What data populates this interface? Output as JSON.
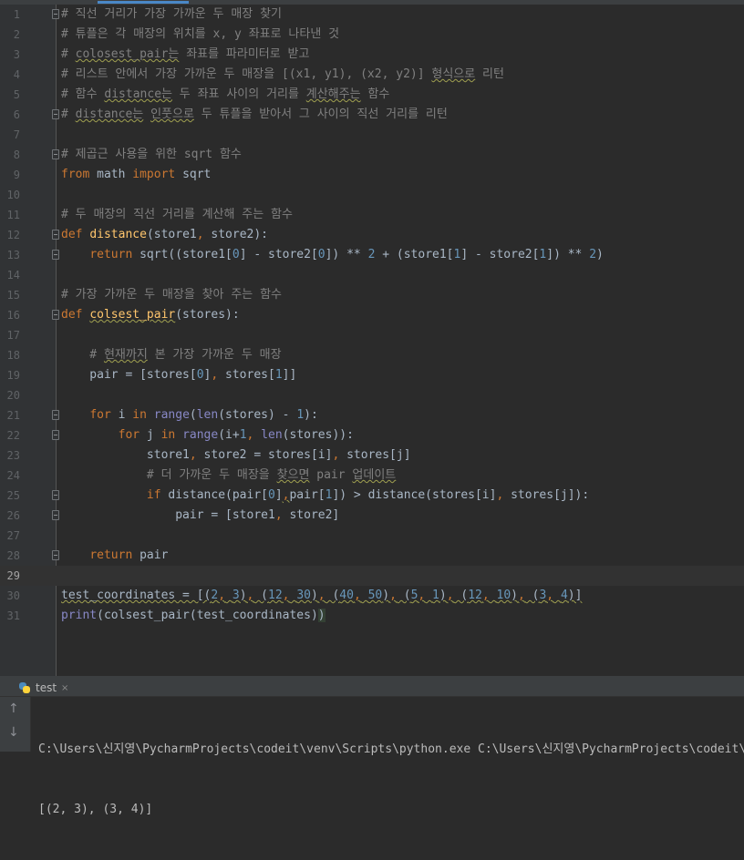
{
  "editor": {
    "lines": [
      {
        "n": "1",
        "fold": true,
        "tokens": [
          {
            "t": "# 직선 거리가 가장 가까운 두 매장 찾기",
            "c": "comment"
          }
        ]
      },
      {
        "n": "2",
        "tokens": [
          {
            "t": "# 튜플은 각 매장의 위치를 x, y 좌표로 나타낸 것",
            "c": "comment"
          }
        ]
      },
      {
        "n": "3",
        "tokens": [
          {
            "t": "# ",
            "c": "comment"
          },
          {
            "t": "colosest_pair는",
            "c": "comment warn"
          },
          {
            "t": " 좌표를 파라미터로 받고",
            "c": "comment"
          }
        ]
      },
      {
        "n": "4",
        "tokens": [
          {
            "t": "# 리스트 안에서 가장 가까운 두 매장을 [(x1, y1), (x2, y2)] ",
            "c": "comment"
          },
          {
            "t": "형식으로",
            "c": "comment warn"
          },
          {
            "t": " 리턴",
            "c": "comment"
          }
        ]
      },
      {
        "n": "5",
        "tokens": [
          {
            "t": "# 함수 ",
            "c": "comment"
          },
          {
            "t": "distance는",
            "c": "comment warn"
          },
          {
            "t": " 두 좌표 사이의 거리를 ",
            "c": "comment"
          },
          {
            "t": "계산해주는",
            "c": "comment warn"
          },
          {
            "t": " 함수",
            "c": "comment"
          }
        ]
      },
      {
        "n": "6",
        "fold": true,
        "tokens": [
          {
            "t": "# ",
            "c": "comment"
          },
          {
            "t": "distance는",
            "c": "comment warn"
          },
          {
            "t": " ",
            "c": "comment"
          },
          {
            "t": "인풋으로",
            "c": "comment warn"
          },
          {
            "t": " 두 튜플을 받아서 그 사이의 직선 거리를 리턴",
            "c": "comment"
          }
        ]
      },
      {
        "n": "7",
        "tokens": []
      },
      {
        "n": "8",
        "fold": true,
        "tokens": [
          {
            "t": "# 제곱근 사용을 위한 sqrt 함수",
            "c": "comment"
          }
        ]
      },
      {
        "n": "9",
        "tokens": [
          {
            "t": "from",
            "c": "kw"
          },
          {
            "t": " math ",
            "c": ""
          },
          {
            "t": "import",
            "c": "kw"
          },
          {
            "t": " sqrt",
            "c": ""
          }
        ]
      },
      {
        "n": "10",
        "tokens": []
      },
      {
        "n": "11",
        "tokens": [
          {
            "t": "# 두 매장의 직선 거리를 계산해 주는 함수",
            "c": "comment"
          }
        ]
      },
      {
        "n": "12",
        "fold": true,
        "tokens": [
          {
            "t": "def",
            "c": "kw"
          },
          {
            "t": " ",
            "c": ""
          },
          {
            "t": "distance",
            "c": "fn"
          },
          {
            "t": "(store1",
            "c": ""
          },
          {
            "t": ",",
            "c": "kw"
          },
          {
            "t": " store2):",
            "c": ""
          }
        ]
      },
      {
        "n": "13",
        "fold": true,
        "tokens": [
          {
            "t": "    ",
            "c": ""
          },
          {
            "t": "return",
            "c": "kw"
          },
          {
            "t": " sqrt((store1[",
            "c": ""
          },
          {
            "t": "0",
            "c": "num"
          },
          {
            "t": "] - store2[",
            "c": ""
          },
          {
            "t": "0",
            "c": "num"
          },
          {
            "t": "]) ** ",
            "c": ""
          },
          {
            "t": "2",
            "c": "num"
          },
          {
            "t": " + (store1[",
            "c": ""
          },
          {
            "t": "1",
            "c": "num"
          },
          {
            "t": "] - store2[",
            "c": ""
          },
          {
            "t": "1",
            "c": "num"
          },
          {
            "t": "]) ** ",
            "c": ""
          },
          {
            "t": "2",
            "c": "num"
          },
          {
            "t": ")",
            "c": ""
          }
        ]
      },
      {
        "n": "14",
        "tokens": []
      },
      {
        "n": "15",
        "tokens": [
          {
            "t": "# 가장 가까운 두 매장을 찾아 주는 함수",
            "c": "comment"
          }
        ]
      },
      {
        "n": "16",
        "fold": true,
        "tokens": [
          {
            "t": "def",
            "c": "kw"
          },
          {
            "t": " ",
            "c": ""
          },
          {
            "t": "colsest_pair",
            "c": "fn warn"
          },
          {
            "t": "(stores):",
            "c": ""
          }
        ]
      },
      {
        "n": "17",
        "tokens": []
      },
      {
        "n": "18",
        "tokens": [
          {
            "t": "    # ",
            "c": "comment"
          },
          {
            "t": "현재까지",
            "c": "comment warn"
          },
          {
            "t": " 본 가장 가까운 두 매장",
            "c": "comment"
          }
        ]
      },
      {
        "n": "19",
        "tokens": [
          {
            "t": "    pair = [stores[",
            "c": ""
          },
          {
            "t": "0",
            "c": "num"
          },
          {
            "t": "]",
            "c": ""
          },
          {
            "t": ",",
            "c": "kw"
          },
          {
            "t": " stores[",
            "c": ""
          },
          {
            "t": "1",
            "c": "num"
          },
          {
            "t": "]]",
            "c": ""
          }
        ]
      },
      {
        "n": "20",
        "tokens": []
      },
      {
        "n": "21",
        "fold": true,
        "tokens": [
          {
            "t": "    ",
            "c": ""
          },
          {
            "t": "for",
            "c": "kw"
          },
          {
            "t": " i ",
            "c": ""
          },
          {
            "t": "in",
            "c": "kw"
          },
          {
            "t": " ",
            "c": ""
          },
          {
            "t": "range",
            "c": "builtin"
          },
          {
            "t": "(",
            "c": ""
          },
          {
            "t": "len",
            "c": "builtin"
          },
          {
            "t": "(stores) - ",
            "c": ""
          },
          {
            "t": "1",
            "c": "num"
          },
          {
            "t": "):",
            "c": ""
          }
        ]
      },
      {
        "n": "22",
        "fold": true,
        "tokens": [
          {
            "t": "        ",
            "c": ""
          },
          {
            "t": "for",
            "c": "kw"
          },
          {
            "t": " j ",
            "c": ""
          },
          {
            "t": "in",
            "c": "kw"
          },
          {
            "t": " ",
            "c": ""
          },
          {
            "t": "range",
            "c": "builtin"
          },
          {
            "t": "(i+",
            "c": ""
          },
          {
            "t": "1",
            "c": "num"
          },
          {
            "t": ",",
            "c": "kw"
          },
          {
            "t": " ",
            "c": ""
          },
          {
            "t": "len",
            "c": "builtin"
          },
          {
            "t": "(stores)):",
            "c": ""
          }
        ]
      },
      {
        "n": "23",
        "tokens": [
          {
            "t": "            store1",
            "c": ""
          },
          {
            "t": ",",
            "c": "kw"
          },
          {
            "t": " store2 = stores[i]",
            "c": ""
          },
          {
            "t": ",",
            "c": "kw"
          },
          {
            "t": " stores[j]",
            "c": ""
          }
        ]
      },
      {
        "n": "24",
        "tokens": [
          {
            "t": "            # 더 가까운 두 매장을 ",
            "c": "comment"
          },
          {
            "t": "찾으면",
            "c": "comment warn"
          },
          {
            "t": " pair ",
            "c": "comment"
          },
          {
            "t": "업데이트",
            "c": "comment warn"
          }
        ]
      },
      {
        "n": "25",
        "fold": true,
        "tokens": [
          {
            "t": "            ",
            "c": ""
          },
          {
            "t": "if",
            "c": "kw"
          },
          {
            "t": " distance(pair[",
            "c": ""
          },
          {
            "t": "0",
            "c": "num"
          },
          {
            "t": "]",
            "c": ""
          },
          {
            "t": ",",
            "c": "kw warn"
          },
          {
            "t": "pair[",
            "c": ""
          },
          {
            "t": "1",
            "c": "num"
          },
          {
            "t": "]) > distance(stores[i]",
            "c": ""
          },
          {
            "t": ",",
            "c": "kw"
          },
          {
            "t": " stores[j]):",
            "c": ""
          }
        ]
      },
      {
        "n": "26",
        "fold": true,
        "tokens": [
          {
            "t": "                pair = [store1",
            "c": ""
          },
          {
            "t": ",",
            "c": "kw"
          },
          {
            "t": " store2]",
            "c": ""
          }
        ]
      },
      {
        "n": "27",
        "tokens": []
      },
      {
        "n": "28",
        "fold": true,
        "tokens": [
          {
            "t": "    ",
            "c": ""
          },
          {
            "t": "return",
            "c": "kw"
          },
          {
            "t": " pair",
            "c": ""
          }
        ]
      },
      {
        "n": "29",
        "current": true,
        "tokens": []
      },
      {
        "n": "30",
        "tokens": [
          {
            "t": "test_coordinates = [(",
            "c": "warn"
          },
          {
            "t": "2",
            "c": "num warn"
          },
          {
            "t": ",",
            "c": "kw warn"
          },
          {
            "t": " ",
            "c": "warn"
          },
          {
            "t": "3",
            "c": "num warn"
          },
          {
            "t": ")",
            "c": "warn"
          },
          {
            "t": ",",
            "c": "kw warn"
          },
          {
            "t": " (",
            "c": "warn"
          },
          {
            "t": "12",
            "c": "num warn"
          },
          {
            "t": ",",
            "c": "kw warn"
          },
          {
            "t": " ",
            "c": "warn"
          },
          {
            "t": "30",
            "c": "num warn"
          },
          {
            "t": ")",
            "c": "warn"
          },
          {
            "t": ",",
            "c": "kw warn"
          },
          {
            "t": " (",
            "c": "warn"
          },
          {
            "t": "40",
            "c": "num warn"
          },
          {
            "t": ",",
            "c": "kw warn"
          },
          {
            "t": " ",
            "c": "warn"
          },
          {
            "t": "50",
            "c": "num warn"
          },
          {
            "t": ")",
            "c": "warn"
          },
          {
            "t": ",",
            "c": "kw warn"
          },
          {
            "t": " (",
            "c": "warn"
          },
          {
            "t": "5",
            "c": "num warn"
          },
          {
            "t": ",",
            "c": "kw warn"
          },
          {
            "t": " ",
            "c": "warn"
          },
          {
            "t": "1",
            "c": "num warn"
          },
          {
            "t": ")",
            "c": "warn"
          },
          {
            "t": ",",
            "c": "kw warn"
          },
          {
            "t": " (",
            "c": "warn"
          },
          {
            "t": "12",
            "c": "num warn"
          },
          {
            "t": ",",
            "c": "kw warn"
          },
          {
            "t": " ",
            "c": "warn"
          },
          {
            "t": "10",
            "c": "num warn"
          },
          {
            "t": ")",
            "c": "warn"
          },
          {
            "t": ",",
            "c": "kw warn"
          },
          {
            "t": " (",
            "c": "warn"
          },
          {
            "t": "3",
            "c": "num warn"
          },
          {
            "t": ",",
            "c": "kw warn"
          },
          {
            "t": " ",
            "c": "warn"
          },
          {
            "t": "4",
            "c": "num warn"
          },
          {
            "t": ")]",
            "c": "warn"
          }
        ]
      },
      {
        "n": "31",
        "tokens": [
          {
            "t": "print",
            "c": "builtin"
          },
          {
            "t": "(colsest_pair(test_coordinates)",
            "c": ""
          },
          {
            "t": ")",
            "c": "hl"
          }
        ]
      }
    ]
  },
  "run_panel": {
    "tab_label": "test",
    "tab_close": "×",
    "up_arrow": "↑",
    "down_arrow": "↓",
    "console_lines": [
      "C:\\Users\\신지영\\PycharmProjects\\codeit\\venv\\Scripts\\python.exe C:\\Users\\신지영\\PycharmProjects\\codeit\\test.py",
      "[(2, 3), (3, 4)]"
    ]
  },
  "icons": {
    "run_tab": "python-icon",
    "rerun_up": "arrow-up-icon",
    "rerun_down": "arrow-down-icon"
  },
  "colors": {
    "background": "#2b2b2b",
    "comment": "#808080",
    "keyword": "#cc7832",
    "function": "#ffc66d",
    "number": "#6897bb",
    "builtin": "#8888c6",
    "text": "#a9b7c6"
  }
}
